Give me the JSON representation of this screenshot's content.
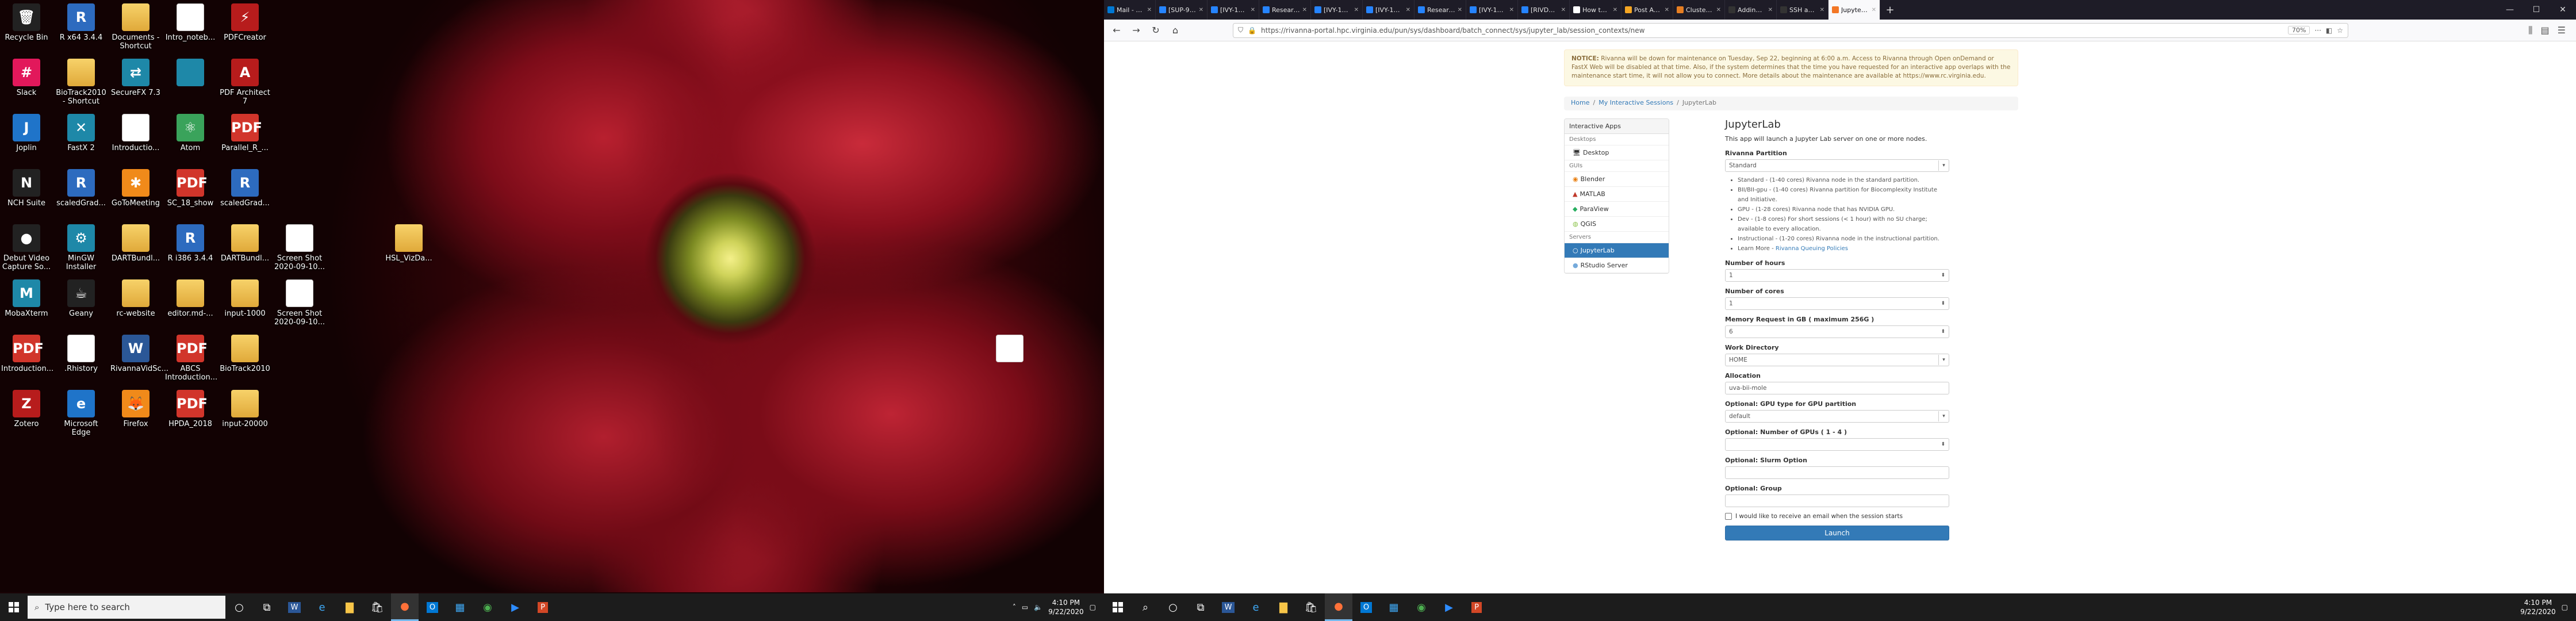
{
  "desktop": {
    "icons": [
      {
        "label": "Recycle Bin",
        "icon": "recycle-bin-icon",
        "glyph": "🗑",
        "style": "g-dark"
      },
      {
        "label": "R x64 3.4.4",
        "icon": "r-icon",
        "glyph": "R",
        "style": "g-rcirc"
      },
      {
        "label": "Documents - Shortcut",
        "icon": "folder-icon",
        "glyph": "",
        "style": "g-folder"
      },
      {
        "label": "Intro_noteb...",
        "icon": "document-icon",
        "glyph": "",
        "style": "g-doc"
      },
      {
        "label": "PDFCreator",
        "icon": "pdfcreator-icon",
        "glyph": "⚡",
        "style": "g-red"
      },
      {
        "label": "Slack",
        "icon": "slack-icon",
        "glyph": "#",
        "style": "g-pink"
      },
      {
        "label": "BioTrack2010 - Shortcut",
        "icon": "folder-icon",
        "glyph": "",
        "style": "g-folder"
      },
      {
        "label": "SecureFX 7.3",
        "icon": "securefx-icon",
        "glyph": "⇄",
        "style": "g-teal"
      },
      {
        "label": "",
        "icon": "image-icon",
        "glyph": "",
        "style": "g-teal"
      },
      {
        "label": "PDF Architect 7",
        "icon": "pdf-icon",
        "glyph": "A",
        "style": "g-red"
      },
      {
        "label": "Joplin",
        "icon": "joplin-icon",
        "glyph": "J",
        "style": "g-blue"
      },
      {
        "label": "FastX 2",
        "icon": "fastx-icon",
        "glyph": "✕",
        "style": "g-teal"
      },
      {
        "label": "Introductio...",
        "icon": "document-icon",
        "glyph": "",
        "style": "g-doc"
      },
      {
        "label": "Atom",
        "icon": "atom-icon",
        "glyph": "⚛",
        "style": "g-green"
      },
      {
        "label": "Parallel_R_...",
        "icon": "pdf-icon",
        "glyph": "PDF",
        "style": "g-pdf"
      },
      {
        "label": "NCH Suite",
        "icon": "nch-icon",
        "glyph": "N",
        "style": "g-dark"
      },
      {
        "label": "scaledGrad...",
        "icon": "r-icon",
        "glyph": "R",
        "style": "g-rcirc"
      },
      {
        "label": "GoToMeeting",
        "icon": "gotomeeting-icon",
        "glyph": "✱",
        "style": "g-orange"
      },
      {
        "label": "SC_18_show",
        "icon": "pdf-icon",
        "glyph": "PDF",
        "style": "g-pdf"
      },
      {
        "label": "scaledGrad...",
        "icon": "r-icon",
        "glyph": "R",
        "style": "g-rcirc"
      },
      {
        "label": "Debut Video Capture So...",
        "icon": "debut-icon",
        "glyph": "●",
        "style": "g-dark"
      },
      {
        "label": "MinGW Installer",
        "icon": "mingw-icon",
        "glyph": "⚙",
        "style": "g-teal"
      },
      {
        "label": "DARTBundl...",
        "icon": "zip-folder-icon",
        "glyph": "",
        "style": "g-folder"
      },
      {
        "label": "R i386 3.4.4",
        "icon": "r-icon",
        "glyph": "R",
        "style": "g-rcirc"
      },
      {
        "label": "DARTBundl...",
        "icon": "zip-folder-icon",
        "glyph": "",
        "style": "g-folder"
      },
      {
        "label": "Screen Shot 2020-09-10...",
        "icon": "image-icon",
        "glyph": "",
        "style": "g-doc"
      },
      {
        "label": "HSL_VizDa...",
        "icon": "folder-icon",
        "glyph": "",
        "style": "g-folder"
      },
      {
        "label": "MobaXterm",
        "icon": "mobaxterm-icon",
        "glyph": "M",
        "style": "g-teal"
      },
      {
        "label": "Geany",
        "icon": "geany-icon",
        "glyph": "☕",
        "style": "g-dark"
      },
      {
        "label": "rc-website",
        "icon": "folder-icon",
        "glyph": "",
        "style": "g-folder"
      },
      {
        "label": "editor.md-...",
        "icon": "folder-icon",
        "glyph": "",
        "style": "g-folder"
      },
      {
        "label": "input-1000",
        "icon": "zip-folder-icon",
        "glyph": "",
        "style": "g-folder"
      },
      {
        "label": "Screen Shot 2020-09-10...",
        "icon": "image-icon",
        "glyph": "",
        "style": "g-doc"
      },
      {
        "label": "Introduction...",
        "icon": "pdf-icon",
        "glyph": "PDF",
        "style": "g-pdf"
      },
      {
        "label": ".Rhistory",
        "icon": "document-icon",
        "glyph": "",
        "style": "g-doc"
      },
      {
        "label": "RivannaVidSc...",
        "icon": "word-icon",
        "glyph": "W",
        "style": "g-word"
      },
      {
        "label": "ABCS Introduction...",
        "icon": "pdf-icon",
        "glyph": "PDF",
        "style": "g-pdf"
      },
      {
        "label": "BioTrack2010",
        "icon": "zip-folder-icon",
        "glyph": "",
        "style": "g-folder"
      },
      {
        "label": "",
        "icon": "document-icon",
        "glyph": "",
        "style": "g-doc"
      },
      {
        "label": "Zotero",
        "icon": "zotero-icon",
        "glyph": "Z",
        "style": "g-red"
      },
      {
        "label": "Microsoft Edge",
        "icon": "edge-icon",
        "glyph": "e",
        "style": "g-blue"
      },
      {
        "label": "Firefox",
        "icon": "firefox-icon",
        "glyph": "🦊",
        "style": "g-orange"
      },
      {
        "label": "HPDA_2018",
        "icon": "pdf-icon",
        "glyph": "PDF",
        "style": "g-pdf"
      },
      {
        "label": "input-20000",
        "icon": "zip-folder-icon",
        "glyph": "",
        "style": "g-folder"
      }
    ]
  },
  "taskbar": {
    "search_placeholder": "Type here to search",
    "time": "4:10 PM",
    "date": "9/22/2020",
    "apps": [
      "cortana-icon",
      "task-view-icon",
      "word-icon",
      "edge-icon",
      "explorer-icon",
      "store-icon",
      "firefox-icon",
      "outlook-icon",
      "calendar-icon",
      "chrome-icon",
      "zoom-icon",
      "powerpoint-icon"
    ]
  },
  "browser": {
    "tabs": [
      {
        "label": "Mail - Hubard, Jo...",
        "color": "#0078d4"
      },
      {
        "label": "[SUP-916] help w...",
        "color": "#2684ff"
      },
      {
        "label": "[IVY-1390] Inquiry...",
        "color": "#2684ff"
      },
      {
        "label": "Research Comput...",
        "color": "#2684ff"
      },
      {
        "label": "[IVY-1376] [UVA...",
        "color": "#2684ff"
      },
      {
        "label": "[IVY-1278] [UVA...",
        "color": "#2684ff"
      },
      {
        "label": "Research Compu...",
        "color": "#2684ff"
      },
      {
        "label": "[IVY-1334] [UVA...",
        "color": "#2684ff"
      },
      {
        "label": "[RIVDEV-111] Sc...",
        "color": "#2684ff"
      },
      {
        "label": "How to transcrib...",
        "color": "#ffffff"
      },
      {
        "label": "Post Attendee",
        "color": "#f5a623"
      },
      {
        "label": "Cluster Storage |...",
        "color": "#e67e22"
      },
      {
        "label": "Adding a new SSH...",
        "color": "#333333"
      },
      {
        "label": "SSH and GPG keys",
        "color": "#333333"
      },
      {
        "label": "JupyterLab",
        "color": "#f37726"
      }
    ],
    "url": "https://rivanna-portal.hpc.virginia.edu/pun/sys/dashboard/batch_connect/sys/jupyter_lab/session_contexts/new",
    "zoom": "70%"
  },
  "notice": {
    "label": "NOTICE:",
    "text": "Rivanna will be down for maintenance on Tuesday, Sep 22, beginning at 6:00 a.m. Access to Rivanna through Open onDemand or FastX Web will be disabled at that time. Also, if the system determines that the time you have requested for an interactive app overlaps with the maintenance start time, it will not allow you to connect. More details about the maintenance are available at https://www.rc.virginia.edu."
  },
  "breadcrumb": {
    "home": "Home",
    "sessions": "My Interactive Sessions",
    "current": "JupyterLab"
  },
  "sidenav": {
    "title": "Interactive Apps",
    "cat_desktops": "Desktops",
    "desktop": "Desktop",
    "cat_gui": "GUIs",
    "blender": "Blender",
    "matlab": "MATLAB",
    "paraview": "ParaView",
    "qgis": "QGIS",
    "cat_servers": "Servers",
    "jupyterlab": "JupyterLab",
    "rstudio": "RStudio Server"
  },
  "form": {
    "title": "JupyterLab",
    "intro": "This app will launch a Jupyter Lab server on one or more nodes.",
    "partition_label": "Rivanna Partition",
    "partition_value": "Standard",
    "partition_help": [
      "Standard - (1-40 cores) Rivanna node in the standard partition.",
      "BII/BII-gpu - (1-40 cores) Rivanna partition for Biocomplexity Institute and Initiative.",
      "GPU - (1-28 cores) Rivanna node that has NVIDIA GPU.",
      "Dev - (1-8 cores) For short sessions (< 1 hour) with no SU charge; available to every allocation.",
      "Instructional - (1-20 cores) Rivanna node in the instructional partition."
    ],
    "learn_more": "Learn More -",
    "learn_more_link": "Rivanna Queuing Policies",
    "hours_label": "Number of hours",
    "hours_value": "1",
    "cores_label": "Number of cores",
    "cores_value": "1",
    "memory_label": "Memory Request in GB ( maximum 256G )",
    "memory_value": "6",
    "workdir_label": "Work Directory",
    "workdir_value": "HOME",
    "allocation_label": "Allocation",
    "allocation_value": "uva-bii-mole",
    "gputype_label": "Optional: GPU type for GPU partition",
    "gputype_value": "default",
    "gpus_label": "Optional: Number of GPUs ( 1 - 4 )",
    "gpus_value": "",
    "slurm_label": "Optional: Slurm Option",
    "slurm_value": "",
    "group_label": "Optional: Group",
    "group_value": "",
    "email_label": "I would like to receive an email when the session starts",
    "launch_label": "Launch"
  },
  "taskbar2": {
    "time": "4:10 PM",
    "date": "9/22/2020"
  }
}
